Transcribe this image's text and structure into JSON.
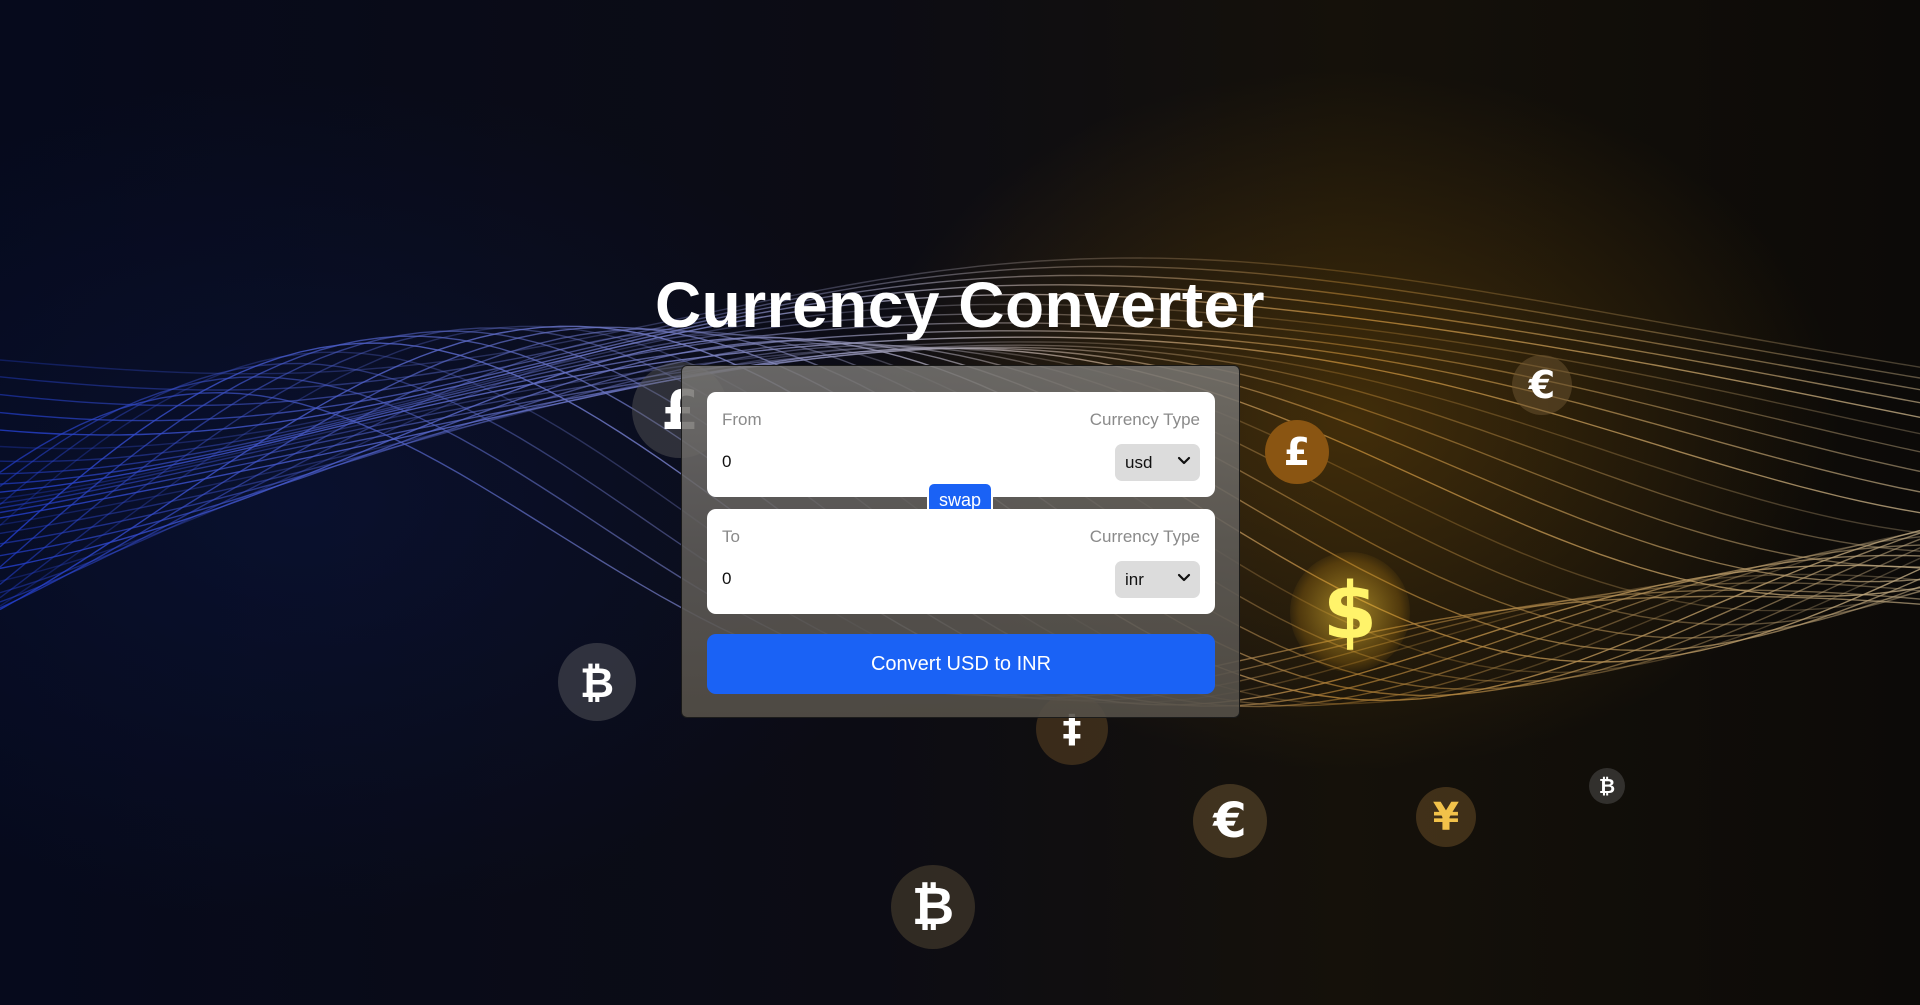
{
  "page": {
    "title": "Currency Converter"
  },
  "converter": {
    "from": {
      "label": "From",
      "currency_type_label": "Currency Type",
      "amount": "0",
      "currency": "usd"
    },
    "swap_label": "swap",
    "to": {
      "label": "To",
      "currency_type_label": "Currency Type",
      "amount": "0",
      "currency": "inr"
    },
    "convert_label": "Convert USD to INR"
  },
  "colors": {
    "accent": "#1a62f5",
    "box_background": "#ffffff",
    "select_background": "#dcdcdc"
  },
  "background_icons": [
    "pound-coin-icon",
    "euro-coin-icon",
    "pound-coin-icon",
    "dollar-coin-icon",
    "bitcoin-coin-icon",
    "dagger-coin-icon",
    "euro-coin-icon",
    "yen-coin-icon",
    "bitcoin-coin-icon",
    "bitcoin-coin-icon"
  ]
}
